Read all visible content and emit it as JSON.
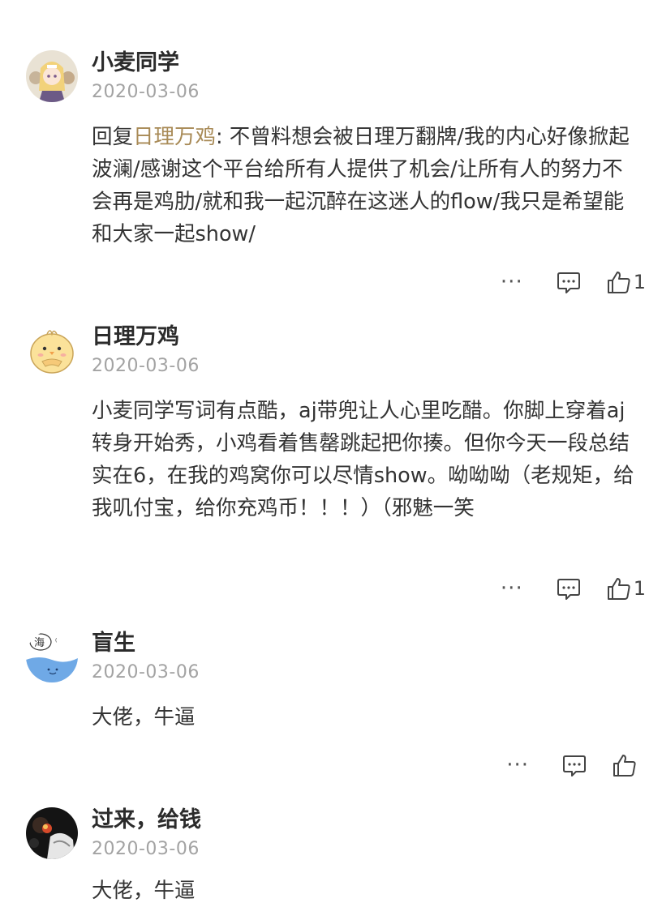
{
  "comments": [
    {
      "author": "小麦同学",
      "date": "2020-03-06",
      "reply_prefix": "回复",
      "reply_to": "日理万鸡",
      "reply_colon": ": ",
      "text": "不曾料想会被日理万翻牌/我的内心好像掀起波澜/感谢这个平台给所有人提供了机会/让所有人的努力不会再是鸡肋/就和我一起沉醉在这迷人的flow/我只是希望能和大家一起show/",
      "more_label": "···",
      "like_count": "1",
      "avatar_icon": "anime-girl-avatar"
    },
    {
      "author": "日理万鸡",
      "date": "2020-03-06",
      "text": "小麦同学写词有点酷，aj带兜让人心里吃醋。你脚上穿着aj转身开始秀，小鸡看着售罄跳起把你揍。但你今天一段总结实在6，在我的鸡窝你可以尽情show。呦呦呦（老规矩，给我叽付宝，给你充鸡币！！！）（邪魅一笑",
      "more_label": "···",
      "like_count": "1",
      "avatar_icon": "chick-avatar"
    },
    {
      "author": "盲生",
      "date": "2020-03-06",
      "text": "大佬，牛逼",
      "more_label": "···",
      "like_count": "",
      "avatar_icon": "sea-drawing-avatar",
      "avatar_text": "海"
    },
    {
      "author": "过来，给钱",
      "date": "2020-03-06",
      "text": "大佬，牛逼",
      "avatar_icon": "dark-photo-avatar"
    }
  ],
  "colors": {
    "mention": "#a88a56",
    "date": "#a3a3a3",
    "name": "#2b2b2b"
  }
}
